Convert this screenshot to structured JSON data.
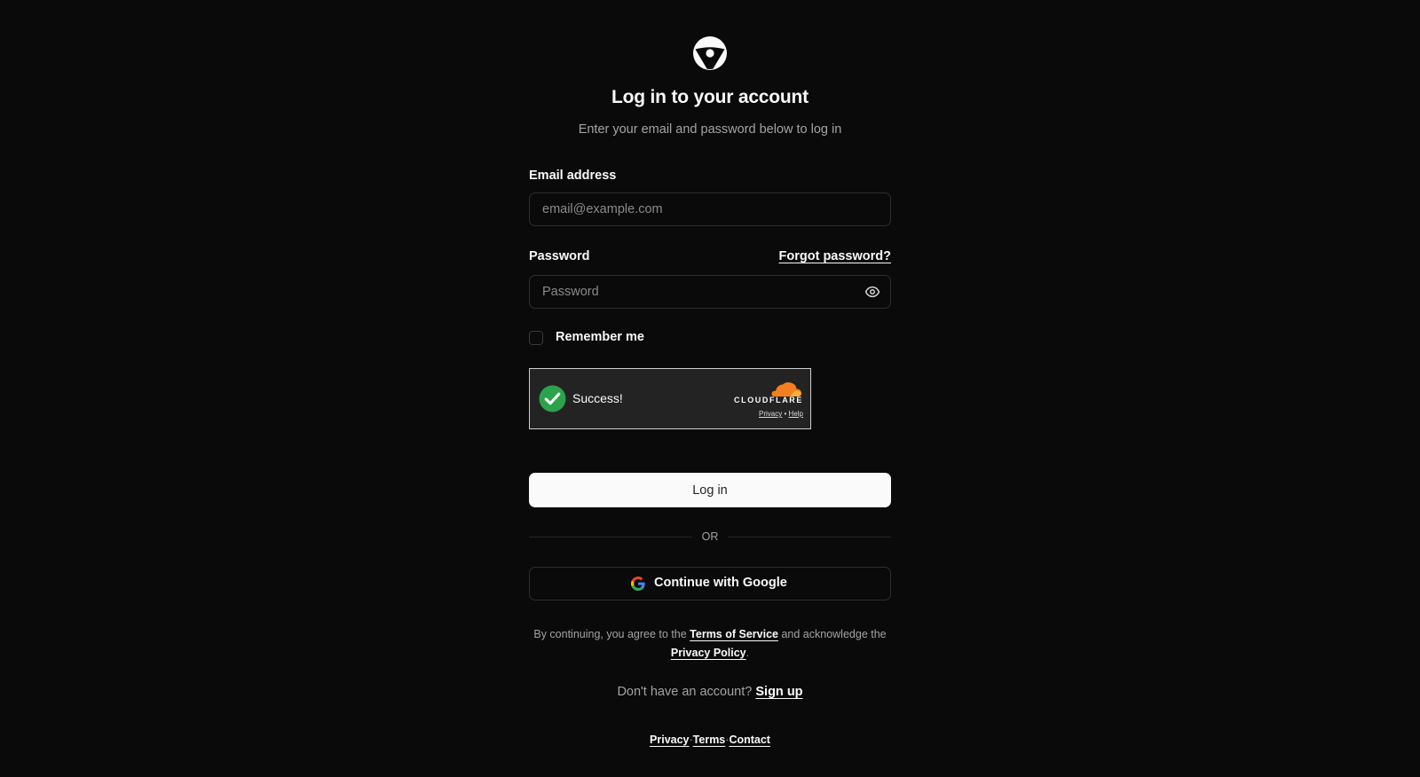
{
  "header": {
    "logo_icon": "brand-logo-icon",
    "title": "Log in to your account",
    "subtitle": "Enter your email and password below to log in"
  },
  "form": {
    "email_label": "Email address",
    "email_placeholder": "email@example.com",
    "email_value": "",
    "password_label": "Password",
    "forgot_password": "Forgot password?",
    "password_placeholder": "Password",
    "password_value": "",
    "password_toggle_icon": "eye-icon",
    "remember_label": "Remember me",
    "remember_checked": false
  },
  "captcha": {
    "status": "Success!",
    "status_icon": "check-circle-icon",
    "provider": "CLOUDFLARE",
    "privacy_link": "Privacy",
    "separator": "•",
    "help_link": "Help"
  },
  "actions": {
    "login_button": "Log in",
    "divider_text": "OR",
    "google_button": "Continue with Google",
    "google_icon": "google-icon"
  },
  "legal": {
    "prefix": "By continuing, you agree to the ",
    "terms_link": "Terms of Service",
    "middle": " and acknowledge the ",
    "privacy_link": "Privacy Policy",
    "suffix": "."
  },
  "signup": {
    "prompt": "Don't have an account? ",
    "link": "Sign up"
  },
  "footer": {
    "privacy": "Privacy",
    "terms": "Terms",
    "contact": "Contact",
    "separator": "·"
  },
  "colors": {
    "background": "#0a0a0a",
    "text": "#fafafa",
    "muted": "#a3a3a3",
    "border": "#2e2e2e",
    "captcha_bg": "#232323",
    "success_green": "#2ba24c",
    "cloudflare_orange": "#f38020"
  }
}
